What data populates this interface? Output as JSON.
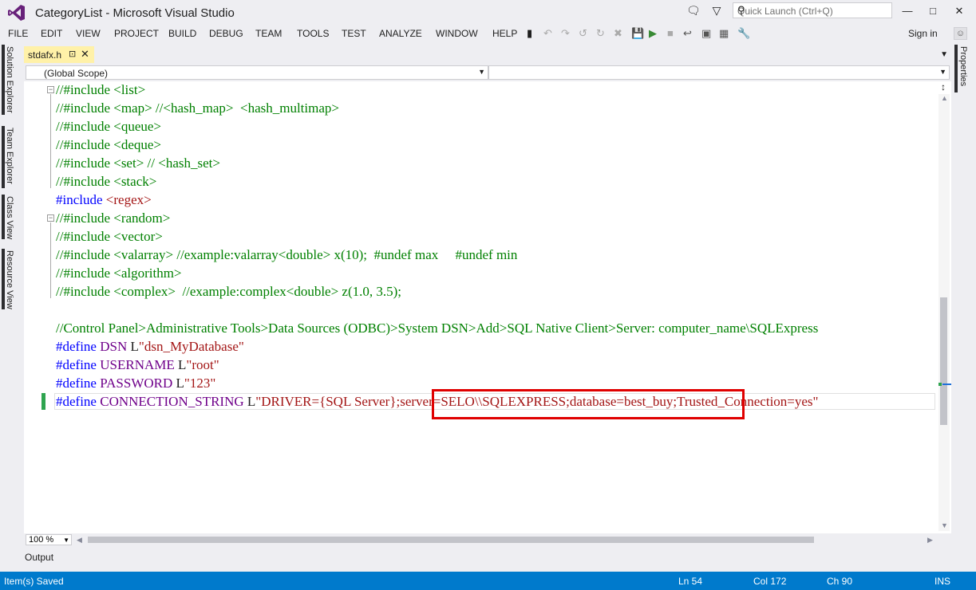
{
  "titlebar": {
    "title": "CategoryList - Microsoft Visual Studio",
    "quick_launch_placeholder": "Quick Launch (Ctrl+Q)",
    "notification_icon": "speech-bubble-icon",
    "feedback_icon": "filter-icon"
  },
  "menu": [
    "FILE",
    "EDIT",
    "VIEW",
    "PROJECT",
    "BUILD",
    "DEBUG",
    "TEAM",
    "TOOLS",
    "TEST",
    "ANALYZE",
    "WINDOW",
    "HELP"
  ],
  "signin": "Sign in",
  "left_tabs": [
    "Solution Explorer",
    "Team Explorer",
    "Class View",
    "Resource View"
  ],
  "right_tabs": [
    "Properties"
  ],
  "doc_tab": {
    "label": "stdafx.h"
  },
  "nav": {
    "scope": "(Global Scope)",
    "member": ""
  },
  "code_lines": [
    {
      "parts": [
        {
          "t": "//#include <list>",
          "c": "c-comment"
        }
      ]
    },
    {
      "parts": [
        {
          "t": "//#include <map> //<hash_map>  <hash_multimap>",
          "c": "c-comment"
        }
      ]
    },
    {
      "parts": [
        {
          "t": "//#include <queue>",
          "c": "c-comment"
        }
      ]
    },
    {
      "parts": [
        {
          "t": "//#include <deque>",
          "c": "c-comment"
        }
      ]
    },
    {
      "parts": [
        {
          "t": "//#include <set> // <hash_set>",
          "c": "c-comment"
        }
      ]
    },
    {
      "parts": [
        {
          "t": "//#include <stack>",
          "c": "c-comment"
        }
      ]
    },
    {
      "parts": [
        {
          "t": "#include ",
          "c": "c-pre"
        },
        {
          "t": "<regex>",
          "c": "c-str"
        }
      ]
    },
    {
      "parts": [
        {
          "t": "//#include <random>",
          "c": "c-comment"
        }
      ]
    },
    {
      "parts": [
        {
          "t": "//#include <vector>",
          "c": "c-comment"
        }
      ]
    },
    {
      "parts": [
        {
          "t": "//#include <valarray> //example:valarray<double> x(10);  #undef max     #undef min",
          "c": "c-comment"
        }
      ]
    },
    {
      "parts": [
        {
          "t": "//#include <algorithm>",
          "c": "c-comment"
        }
      ]
    },
    {
      "parts": [
        {
          "t": "//#include <complex>  //example:complex<double> z(1.0, 3.5);",
          "c": "c-comment"
        }
      ]
    },
    {
      "parts": [
        {
          "t": "",
          "c": "c-plain"
        }
      ]
    },
    {
      "parts": [
        {
          "t": "//Control Panel>Administrative Tools>Data Sources (ODBC)>System DSN>Add>SQL Native Client>Server: computer_name\\SQLExpress",
          "c": "c-comment"
        }
      ]
    },
    {
      "parts": [
        {
          "t": "#define ",
          "c": "c-pre"
        },
        {
          "t": "DSN ",
          "c": "c-macro"
        },
        {
          "t": "L",
          "c": "c-plain"
        },
        {
          "t": "\"dsn_MyDatabase\"",
          "c": "c-str"
        }
      ]
    },
    {
      "parts": [
        {
          "t": "#define ",
          "c": "c-pre"
        },
        {
          "t": "USERNAME ",
          "c": "c-macro"
        },
        {
          "t": "L",
          "c": "c-plain"
        },
        {
          "t": "\"root\"",
          "c": "c-str"
        }
      ]
    },
    {
      "parts": [
        {
          "t": "#define ",
          "c": "c-pre"
        },
        {
          "t": "PASSWORD ",
          "c": "c-macro"
        },
        {
          "t": "L",
          "c": "c-plain"
        },
        {
          "t": "\"123\"",
          "c": "c-str"
        }
      ]
    },
    {
      "parts": [
        {
          "t": "#define ",
          "c": "c-pre"
        },
        {
          "t": "CONNECTION_STRING ",
          "c": "c-macro"
        },
        {
          "t": "L",
          "c": "c-plain"
        },
        {
          "t": "\"DRIVER={SQL Server};server=SELO\\\\SQLEXPRESS;database=best_buy;Trusted_Connection=yes\"",
          "c": "c-str"
        }
      ]
    }
  ],
  "zoom": "100 %",
  "output_tab": "Output",
  "status": {
    "message": "Item(s) Saved",
    "line": "Ln 54",
    "col": "Col 172",
    "ch": "Ch 90",
    "mode": "INS"
  },
  "colors": {
    "accent": "#007acc",
    "comment": "#008000",
    "preprocessor": "#0000ff",
    "string": "#a31515",
    "macro": "#6f008a",
    "highlight_box": "#e00000",
    "doc_tab": "#fff1a8"
  }
}
